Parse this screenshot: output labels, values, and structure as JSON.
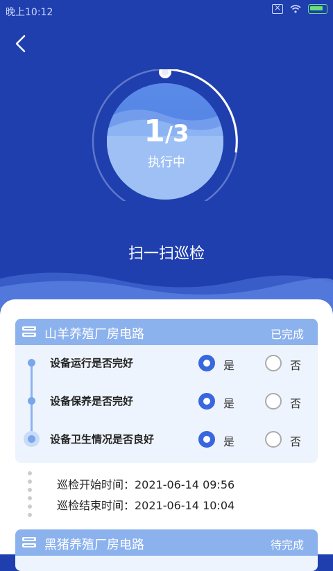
{
  "status_bar": {
    "time": "晚上10:12"
  },
  "header": {
    "title": "扫一扫巡检"
  },
  "progress": {
    "current": "1",
    "separator": "/",
    "total": "3",
    "status": "执行中",
    "fraction": 0.333
  },
  "routes": [
    {
      "name": "山羊养殖厂房电路",
      "status": "已完成",
      "checks": [
        {
          "label": "设备运行是否完好",
          "yes_label": "是",
          "no_label": "否",
          "selected": "yes"
        },
        {
          "label": "设备保养是否完好",
          "yes_label": "是",
          "no_label": "否",
          "selected": "yes"
        },
        {
          "label": "设备卫生情况是否良好",
          "yes_label": "是",
          "no_label": "否",
          "selected": "yes"
        }
      ],
      "start_time": "巡检开始时间：2021-06-14 09:56",
      "end_time": "巡检结束时间：2021-06-14 10:04"
    },
    {
      "name": "黑猪养殖厂房电路",
      "status": "待完成"
    }
  ],
  "colors": {
    "header_bg": "#1f3fae",
    "accent": "#3867df",
    "card_header": "#8cb2ee"
  }
}
